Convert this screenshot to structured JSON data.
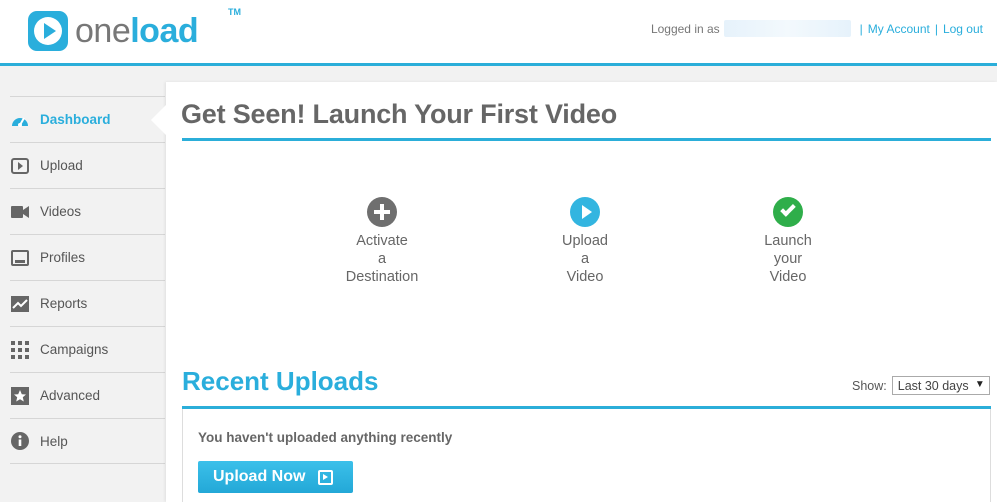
{
  "header": {
    "logo_one": "one",
    "logo_load": "load",
    "logo_tm": "TM",
    "logged_in_label": "Logged in as",
    "sep": "|",
    "my_account": "My Account",
    "log_out": "Log out"
  },
  "sidebar": {
    "items": [
      {
        "label": "Dashboard",
        "icon": "dashboard-icon",
        "active": true
      },
      {
        "label": "Upload",
        "icon": "upload-icon"
      },
      {
        "label": "Videos",
        "icon": "video-camera-icon"
      },
      {
        "label": "Profiles",
        "icon": "profile-icon"
      },
      {
        "label": "Reports",
        "icon": "chart-icon"
      },
      {
        "label": "Campaigns",
        "icon": "grid-icon"
      },
      {
        "label": "Advanced",
        "icon": "star-icon"
      },
      {
        "label": "Help",
        "icon": "info-icon"
      }
    ]
  },
  "main": {
    "title": "Get Seen! Launch Your First Video",
    "steps": [
      {
        "line1": "Activate",
        "line2": "a",
        "line3": "Destination",
        "icon": "plus-circle-icon"
      },
      {
        "line1": "Upload",
        "line2": "a",
        "line3": "Video",
        "icon": "play-circle-icon"
      },
      {
        "line1": "Launch",
        "line2": "your",
        "line3": "Video",
        "icon": "check-circle-icon"
      }
    ],
    "recent": {
      "title": "Recent Uploads",
      "show_label": "Show:",
      "show_value": "Last 30 days",
      "empty_message": "You haven't uploaded anything recently",
      "upload_button": "Upload Now"
    }
  },
  "colors": {
    "accent": "#2aaedc",
    "check_green": "#2fae4a",
    "plus_gray": "#6f6f6f"
  }
}
